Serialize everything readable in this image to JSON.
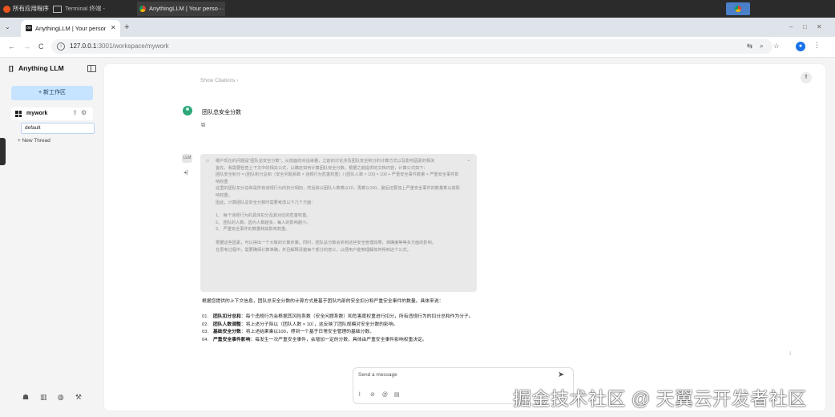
{
  "os_bar": {
    "apps_label": "所有应用程序",
    "terminal_label": "Terminal 终端 -",
    "chrome_label": "AnythingLLM | Your perso···"
  },
  "browser": {
    "tab_title": "AnythingLLM | Your person",
    "url_host": "127.0.0.1",
    "url_rest": ":3001/workspace/mywork"
  },
  "sidebar": {
    "logo": "Anything LLM",
    "new_workspace": "新工作区",
    "workspace_name": "mywork",
    "thread_default": "default",
    "new_thread": "New Thread"
  },
  "chat": {
    "show_citations": "Show Citations",
    "user_message": "团队总安全分数",
    "thinking": [
      "嗯户现在的问题是\"团队总安全分数\"。从前面的对话来看，之前的讨论涉及团队安全积分的计算方式以及影响因素的相关",
      "首先，我需要检查上下文中的相关公式，以确定如何计算团队安全分数。根据之前提供的文档内容，计算公式如下：",
      "团队安全积分 = (团队积分总和（安全问题系数 × 违规行为危害权重）/ (团队人数 × 10)) × 100 + 严重安全事件数量 × 严重安全事件影响权重",
      "这里的团队扣分总和是所有违规行为的扣分相加，然后除以团队人数乘以10，再乘以100，最后还要加上严重安全事件的数量乘以其影响权重。",
      "因此，计算团队总安全分数时需要考虑以下几个方面：",
      "1、  每个违规行为的具体扣分及其对应的危害权重。",
      "2、  团队的人数，因为人数越多，每人的影响越小。",
      "3、  严重安全事件的数量和其影响权重。",
      "根据这些因素，可以得出一个大致的计算步骤。同时，团队总分数会受到这些安全管理效果，准确度等等多方面的影响。",
      "在思考过程中，需要确保计算准确，并且解释清楚每个部分的意义，以便用户能够理解如何得到这个公式。"
    ],
    "answer_intro": "根据您提供的上下文信息，团队总安全分数的计算方式是基于团队内部的安全扣分和严重安全事件的数量。具体来说：",
    "answer_items": [
      {
        "n": "01.",
        "title": "团队扣分总和",
        "text": "：每个违规行为会根据其风险系数（安全问题系数）和危害度权重进行扣分，所有违规行为的扣分总和作为分子。"
      },
      {
        "n": "02.",
        "title": "团队人数调整",
        "text": "：将上述分子除以（团队人数 × 10），这反映了团队规模对安全分数的影响。"
      },
      {
        "n": "03.",
        "title": "基础安全分数",
        "text": "：将上述结果乘以100，得到一个基于日常安全管理的基础分数。"
      },
      {
        "n": "04.",
        "title": "严重安全事件影响",
        "text": "：每发生一次严重安全事件，会增加一定的分数，具体由严重安全事件影响权重决定。"
      }
    ],
    "composer_placeholder": "Send a message"
  },
  "watermark": "掘金技术社区 @ 天翼云开发者社区"
}
